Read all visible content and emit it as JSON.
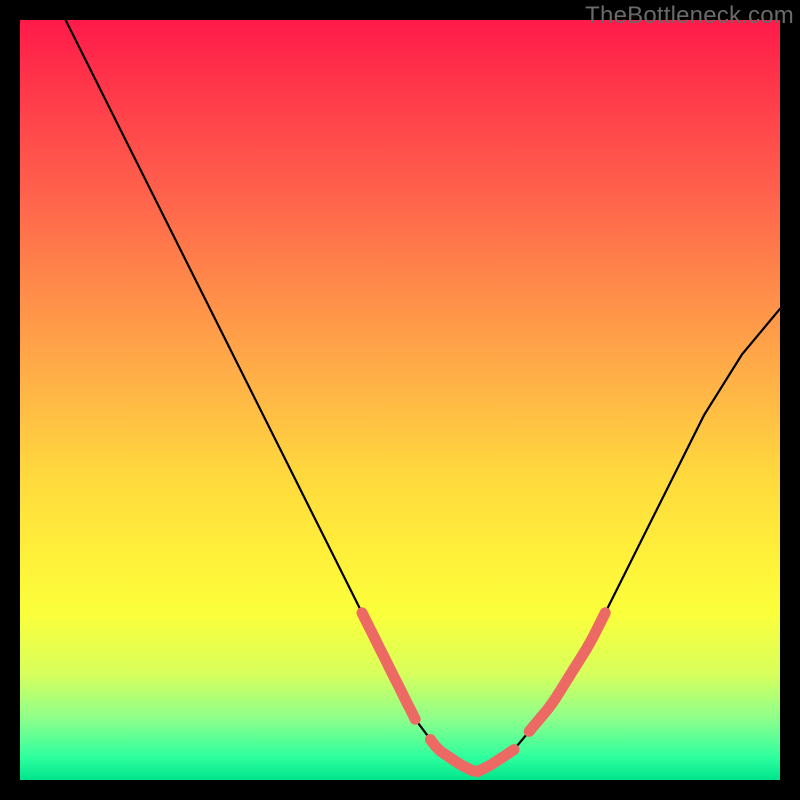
{
  "watermark": "TheBottleneck.com",
  "chart_data": {
    "type": "line",
    "title": "",
    "xlabel": "",
    "ylabel": "",
    "xlim": [
      0,
      100
    ],
    "ylim": [
      0,
      100
    ],
    "grid": false,
    "legend": false,
    "series": [
      {
        "name": "bottleneck-curve",
        "color": "#000000",
        "x": [
          6,
          10,
          15,
          20,
          25,
          30,
          35,
          40,
          45,
          50,
          52,
          55,
          58,
          60,
          62,
          65,
          70,
          75,
          80,
          85,
          90,
          95,
          100
        ],
        "y": [
          100,
          92,
          82,
          72,
          62,
          52,
          42,
          32,
          22,
          12,
          8,
          4,
          2,
          1,
          2,
          4,
          10,
          18,
          28,
          38,
          48,
          56,
          62
        ]
      }
    ],
    "highlight_band": {
      "name": "optimal-zone",
      "color": "#f0716b",
      "x_segments": [
        [
          45,
          52
        ],
        [
          54,
          65
        ],
        [
          67,
          77
        ]
      ],
      "y_approx": [
        18,
        1,
        18
      ]
    },
    "background_gradient": [
      "#ff1a4a",
      "#ffd93d",
      "#00e48c"
    ]
  }
}
